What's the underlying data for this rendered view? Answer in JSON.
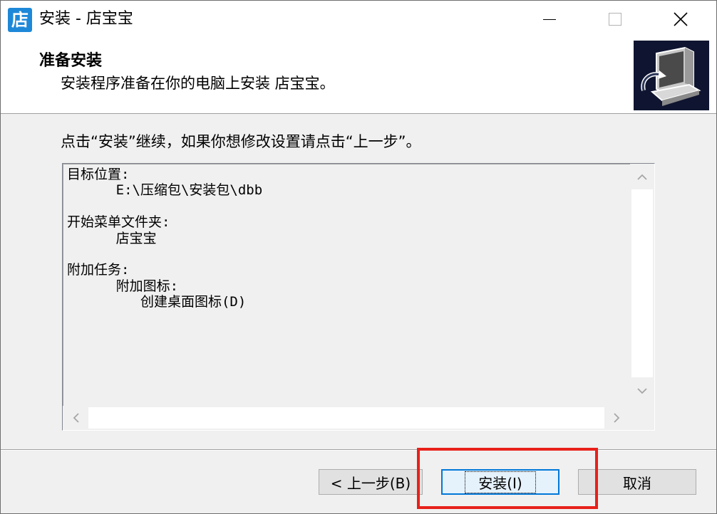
{
  "window": {
    "app_icon_char": "店",
    "title": "安装 - 店宝宝",
    "controls": {
      "minimize": "minimize-icon",
      "maximize": "maximize-icon",
      "close": "close-icon"
    }
  },
  "header": {
    "title": "准备安装",
    "subtitle": "安装程序准备在你的电脑上安装 店宝宝。"
  },
  "content": {
    "instruction": "点击“安装”继续，如果你想修改设置请点击“上一步”。",
    "memo_lines": [
      "目标位置:",
      "      E:\\压缩包\\安装包\\dbb",
      "",
      "开始菜单文件夹:",
      "      店宝宝",
      "",
      "附加任务:",
      "      附加图标:",
      "         创建桌面图标(D)"
    ]
  },
  "buttons": {
    "back": "< 上一步(B)",
    "install": "安装(I)",
    "cancel": "取消"
  },
  "colors": {
    "highlight": "#e8201a",
    "focus": "#0078d7",
    "icon_bg": "#1e88d8"
  }
}
